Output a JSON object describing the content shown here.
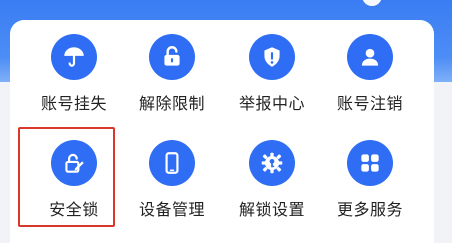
{
  "theme": {
    "accent": "#2f6ef4",
    "highlight": "#d9372b",
    "text": "#222222"
  },
  "services": [
    {
      "label": "账号挂失",
      "icon": "umbrella-icon"
    },
    {
      "label": "解除限制",
      "icon": "unlock-icon"
    },
    {
      "label": "举报中心",
      "icon": "shield-alert-icon"
    },
    {
      "label": "账号注销",
      "icon": "user-icon"
    },
    {
      "label": "安全锁",
      "icon": "lock-edit-icon"
    },
    {
      "label": "设备管理",
      "icon": "phone-icon"
    },
    {
      "label": "解锁设置",
      "icon": "gear-key-icon"
    },
    {
      "label": "更多服务",
      "icon": "apps-grid-icon"
    }
  ],
  "selected_service": "安全锁"
}
